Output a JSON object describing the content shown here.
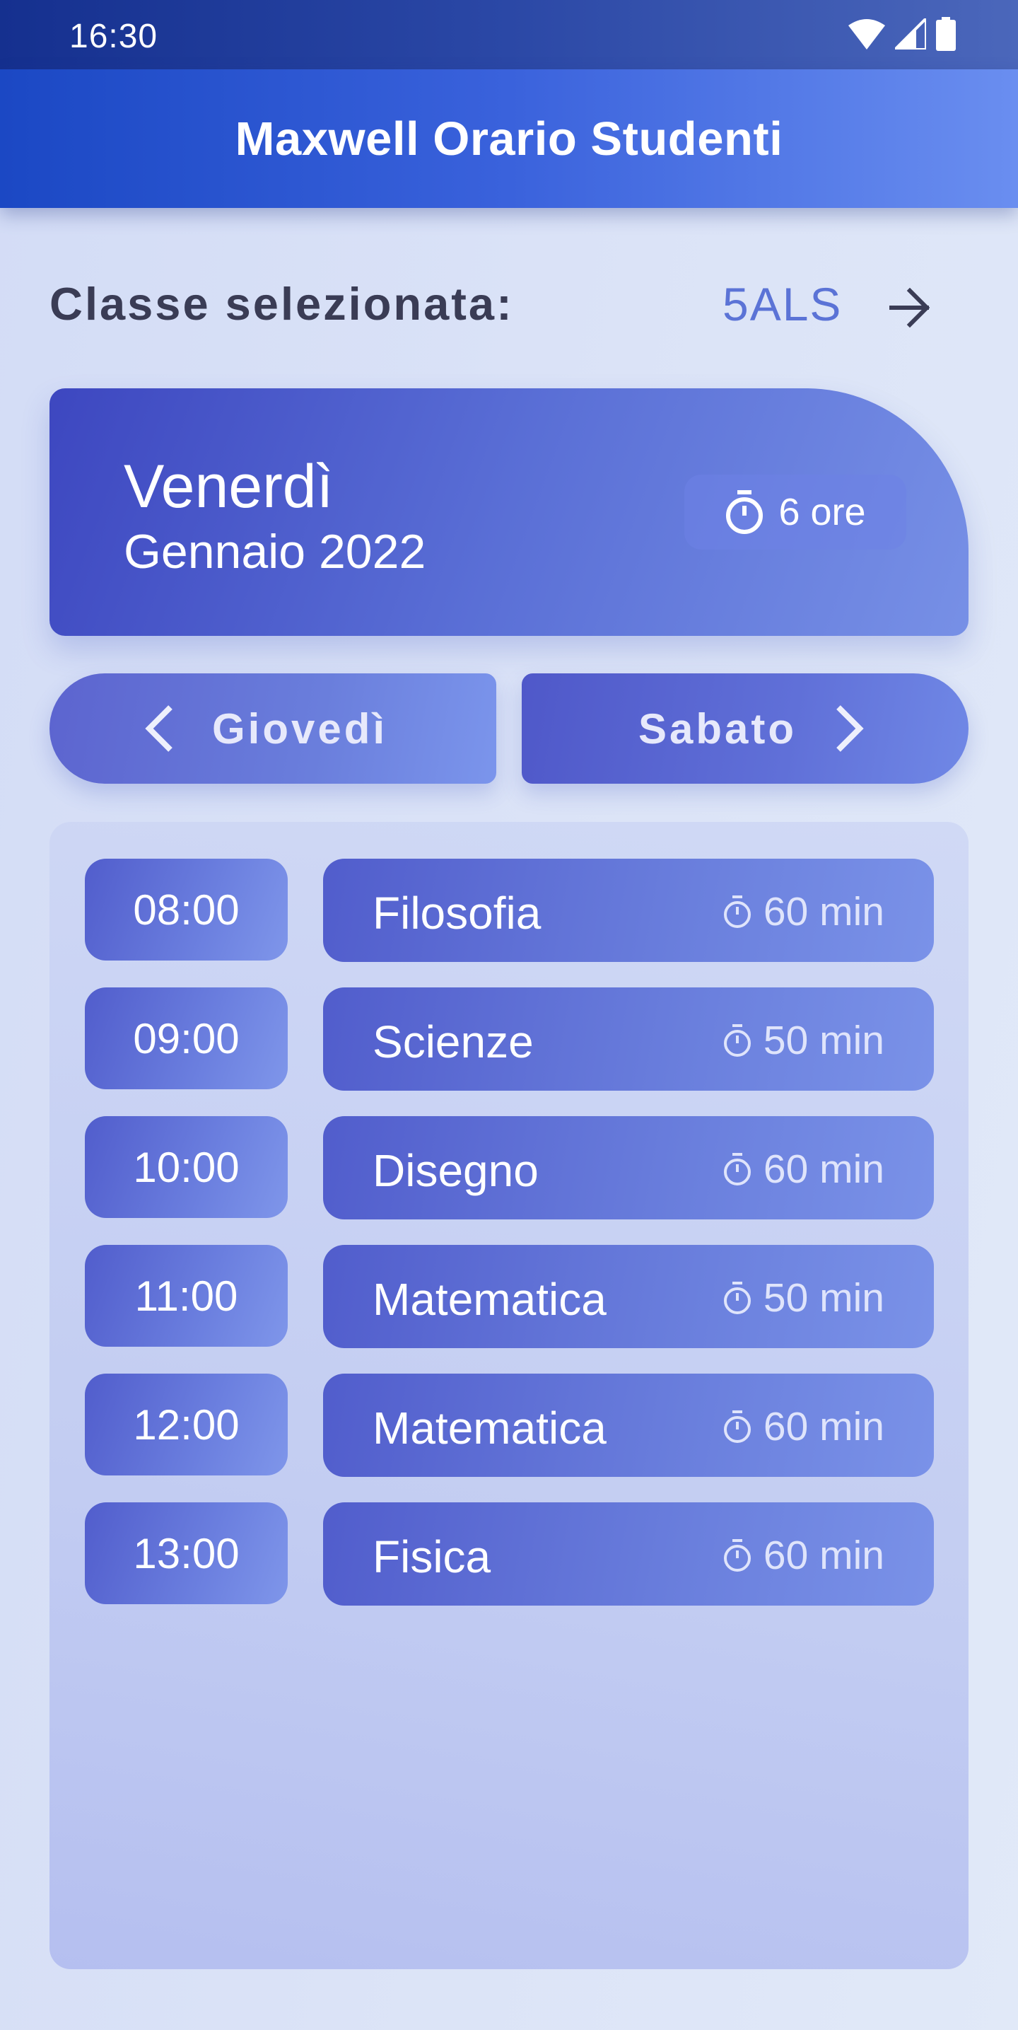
{
  "status_bar": {
    "time": "16:30"
  },
  "app_bar": {
    "title": "Maxwell Orario Studenti"
  },
  "class_selector": {
    "label": "Classe selezionata:",
    "value": "5ALS"
  },
  "day_card": {
    "day": "Venerdì",
    "month_year": "Gennaio 2022",
    "hours": "6 ore"
  },
  "navigation": {
    "prev_label": "Giovedì",
    "next_label": "Sabato"
  },
  "schedule": [
    {
      "time": "08:00",
      "subject": "Filosofia",
      "duration": "60 min"
    },
    {
      "time": "09:00",
      "subject": "Scienze",
      "duration": "50 min"
    },
    {
      "time": "10:00",
      "subject": "Disegno",
      "duration": "60 min"
    },
    {
      "time": "11:00",
      "subject": "Matematica",
      "duration": "50 min"
    },
    {
      "time": "12:00",
      "subject": "Matematica",
      "duration": "60 min"
    },
    {
      "time": "13:00",
      "subject": "Fisica",
      "duration": "60 min"
    }
  ],
  "colors": {
    "accent": "#3a62dc",
    "card": "#5a6fd6",
    "class_value": "#5b73d6"
  },
  "icons": [
    "wifi-icon",
    "cell-signal-icon",
    "battery-icon",
    "arrow-right-icon",
    "timer-icon",
    "chevron-left-icon",
    "chevron-right-icon"
  ]
}
